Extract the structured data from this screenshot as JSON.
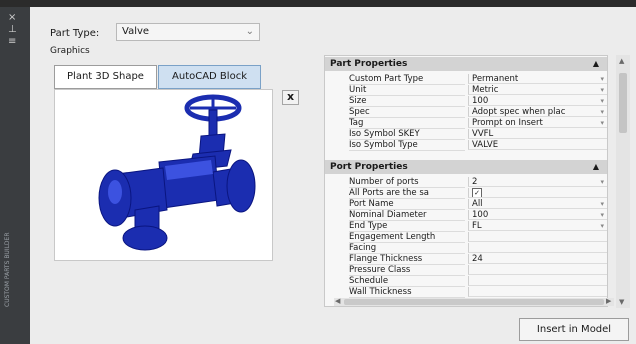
{
  "sidebar": {
    "vertical_title": "CUSTOM PARTS BUILDER",
    "icons": [
      "close-icon",
      "pin-icon",
      "menu-icon"
    ]
  },
  "part_type": {
    "label": "Part Type:",
    "value": "Valve"
  },
  "graphics": {
    "label": "Graphics",
    "tabs": [
      "Plant 3D Shape",
      "AutoCAD Block"
    ],
    "active_tab": "AutoCAD Block",
    "close_label": "x"
  },
  "part_properties": {
    "header": "Part Properties",
    "rows": [
      {
        "key": "Custom Part Type",
        "value": "Permanent",
        "dropdown": true
      },
      {
        "key": "Unit",
        "value": "Metric",
        "dropdown": true
      },
      {
        "key": "Size",
        "value": "100",
        "dropdown": true
      },
      {
        "key": "Spec",
        "value": "Adopt spec when plac",
        "dropdown": true
      },
      {
        "key": "Tag",
        "value": "Prompt on Insert",
        "dropdown": true
      },
      {
        "key": "Iso Symbol SKEY",
        "value": "VVFL",
        "dropdown": false
      },
      {
        "key": "Iso Symbol Type",
        "value": "VALVE",
        "dropdown": false
      }
    ]
  },
  "port_properties": {
    "header": "Port Properties",
    "rows": [
      {
        "key": "Number of ports",
        "value": "2",
        "dropdown": true
      },
      {
        "key": "All Ports are the sa",
        "value": "✓",
        "checkbox": true
      },
      {
        "key": "Port Name",
        "value": "All",
        "dropdown": true
      },
      {
        "key": "Nominal Diameter",
        "value": "100",
        "dropdown": true
      },
      {
        "key": "End Type",
        "value": "FL",
        "dropdown": true
      },
      {
        "key": "Engagement Length",
        "value": ""
      },
      {
        "key": "Facing",
        "value": ""
      },
      {
        "key": "Flange Thickness",
        "value": "24"
      },
      {
        "key": "Pressure Class",
        "value": ""
      },
      {
        "key": "Schedule",
        "value": ""
      },
      {
        "key": "Wall Thickness",
        "value": ""
      }
    ]
  },
  "insert_button": "Insert in Model",
  "colors": {
    "valve": "#1b2db0",
    "header": "#d3d3d3",
    "active_tab": "#cfe0f1"
  }
}
